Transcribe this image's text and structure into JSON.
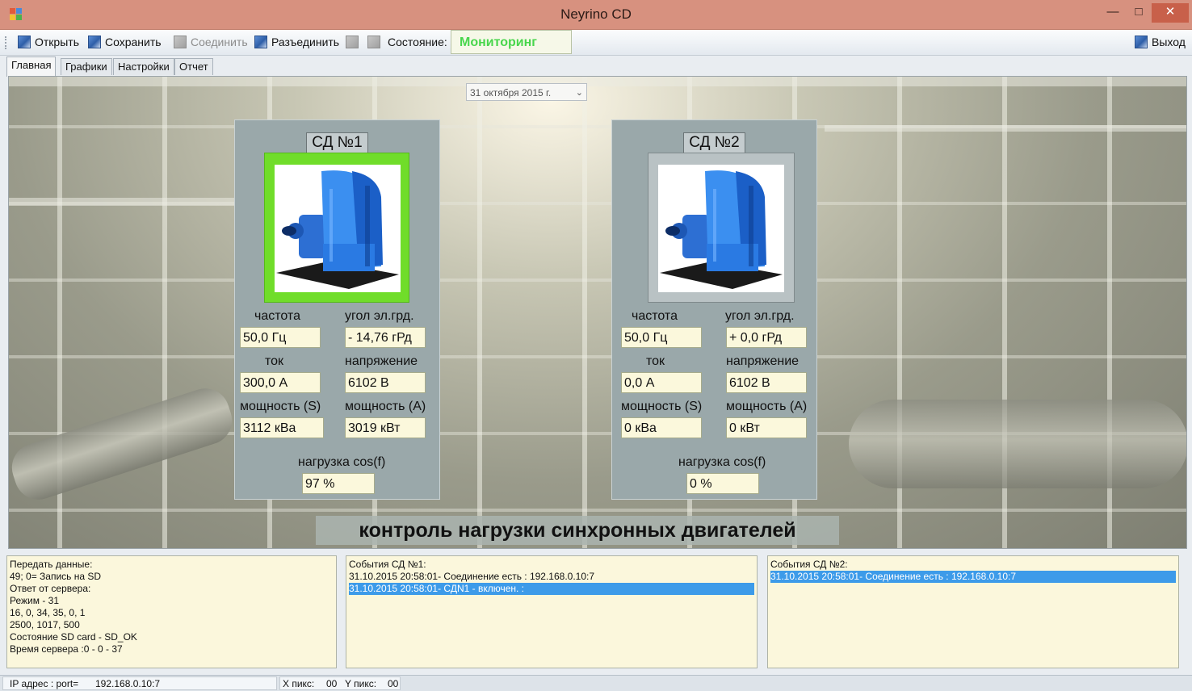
{
  "window": {
    "title": "Neyrino CD"
  },
  "toolbar": {
    "open": "Открыть",
    "save": "Сохранить",
    "connect": "Соединить",
    "disconnect": "Разъединить",
    "state_label": "Состояние:",
    "state_value": "Мониторинг",
    "exit": "Выход"
  },
  "tabs": [
    "Главная",
    "Графики",
    "Настройки",
    "Отчет"
  ],
  "date_picker": {
    "value": "31 октября  2015 г."
  },
  "labels": {
    "frequency": "частота",
    "angle": "угол эл.грд.",
    "current": "ток",
    "voltage": "напряжение",
    "power_s": "мощность (S)",
    "power_a": "мощность (А)",
    "load": "нагрузка cos(f)"
  },
  "motors": [
    {
      "title": "СД №1",
      "status_color": "#70dd2a",
      "frequency": "50,0 Гц",
      "angle": "- 14,76 гРд",
      "current": "300,0 А",
      "voltage": "6102 В",
      "power_s": "3112 кВа",
      "power_a": "3019 кВт",
      "load": "97 %"
    },
    {
      "title": "СД №2",
      "status_color": "#b9c2c4",
      "frequency": "50,0 Гц",
      "angle": "+ 0,0 гРд",
      "current": "0,0 А",
      "voltage": "6102 В",
      "power_s": "0 кВа",
      "power_a": "0 кВт",
      "load": "0 %"
    }
  ],
  "banner": "контроль нагрузки синхронных двигателей",
  "logs": {
    "server": [
      "Передать данные:",
      "49; 0= Запись на SD",
      "Ответ от сервера:",
      "Режим - 31",
      "16, 0, 34, 35, 0, 1",
      "2500, 1017, 500",
      "Состояние SD card - SD_OK",
      "Время сервера :0 - 0 - 37"
    ],
    "events1": [
      "События СД №1:",
      "31.10.2015 20:58:01-  Соединение есть : 192.168.0.10:7",
      "31.10.2015 20:58:01-  СДN1 - включен. :"
    ],
    "events2": [
      "События СД №2:",
      "31.10.2015 20:58:01-  Соединение есть : 192.168.0.10:7"
    ]
  },
  "statusbar": {
    "ip_label": "IP адрес : port=",
    "ip_value": "192.168.0.10:7",
    "x_label": "X пикс:",
    "x_value": "00",
    "y_label": "Y пикс:",
    "y_value": "00"
  }
}
